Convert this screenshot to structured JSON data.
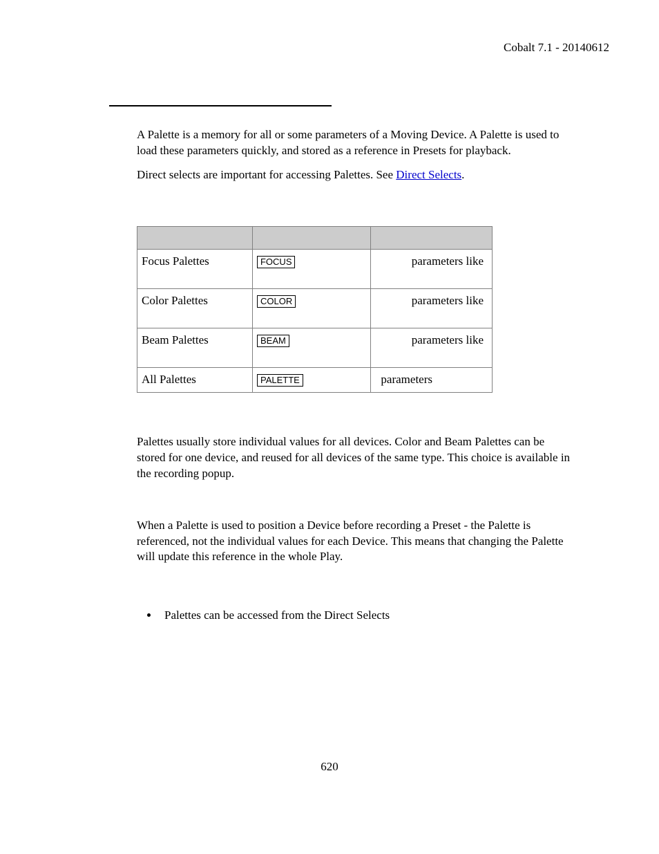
{
  "header": {
    "title": "Cobalt 7.1 - 20140612"
  },
  "intro": {
    "p1": "A Palette is a memory for all or some parameters of a Moving Device. A Palette is used to load these parameters quickly, and stored as a reference in Presets for playback.",
    "p2_pre": "Direct selects are important for accessing Palettes. See ",
    "p2_link": "Direct Selects",
    "p2_post": "."
  },
  "table": {
    "rows": [
      {
        "label": "Focus Palettes",
        "key": "FOCUS",
        "desc": "parameters like"
      },
      {
        "label": "Color Palettes",
        "key": "COLOR",
        "desc": "parameters like"
      },
      {
        "label": "Beam Palettes",
        "key": "BEAM",
        "desc": "parameters like"
      },
      {
        "label": "All Palettes",
        "key": "PALETTE",
        "desc": "parameters"
      }
    ]
  },
  "sections": {
    "para1": "Palettes usually store individual values for all devices. Color and Beam Palettes can be stored for one device, and reused for all devices of the same type. This choice is available in the recording popup.",
    "para2": "When a Palette is used to position a Device before recording a Preset - the Palette is referenced, not the individual values for each Device. This means that changing the Palette will update this reference in the whole Play.",
    "bullet1": "Palettes can be accessed from the Direct Selects"
  },
  "pagenum": "620"
}
